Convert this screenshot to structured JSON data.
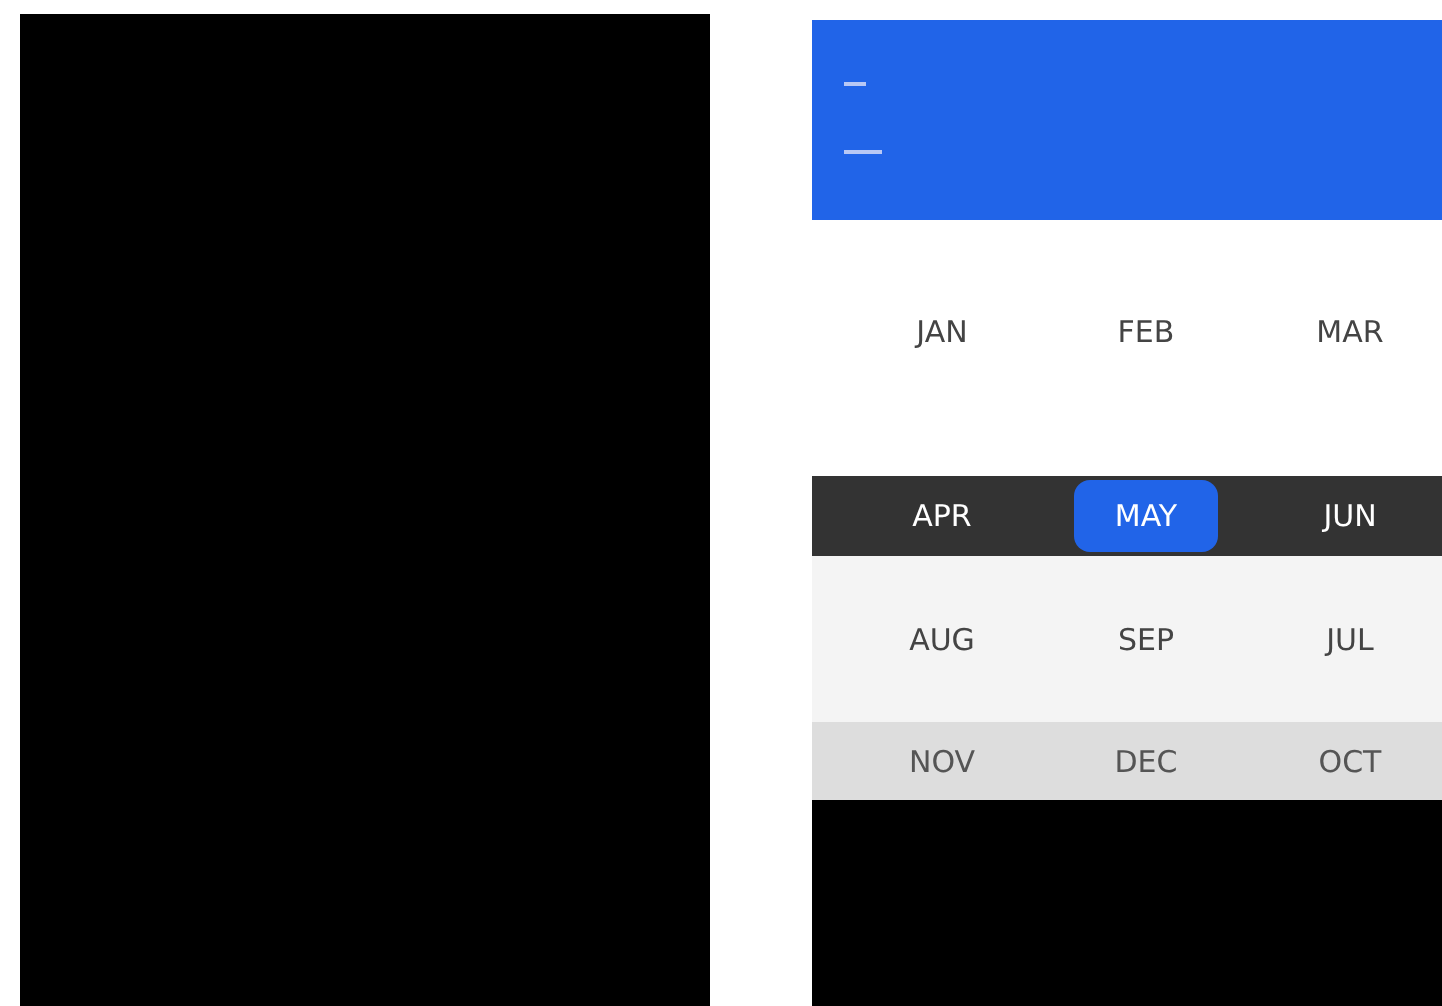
{
  "month_rows": [
    {
      "kind": "plain",
      "months": [
        {
          "label": "JAN",
          "selected": false
        },
        {
          "label": "FEB",
          "selected": false
        },
        {
          "label": "MAR",
          "selected": false
        }
      ]
    },
    {
      "kind": "dark",
      "months": [
        {
          "label": "APR",
          "selected": false
        },
        {
          "label": "MAY",
          "selected": true
        },
        {
          "label": "JUN",
          "selected": false
        }
      ]
    },
    {
      "kind": "light",
      "months": [
        {
          "label": "AUG",
          "selected": false
        },
        {
          "label": "SEP",
          "selected": false
        },
        {
          "label": "JUL",
          "selected": false
        }
      ]
    },
    {
      "kind": "gray",
      "months": [
        {
          "label": "NOV",
          "selected": false
        },
        {
          "label": "DEC",
          "selected": false
        },
        {
          "label": "OCT",
          "selected": false
        }
      ]
    }
  ]
}
